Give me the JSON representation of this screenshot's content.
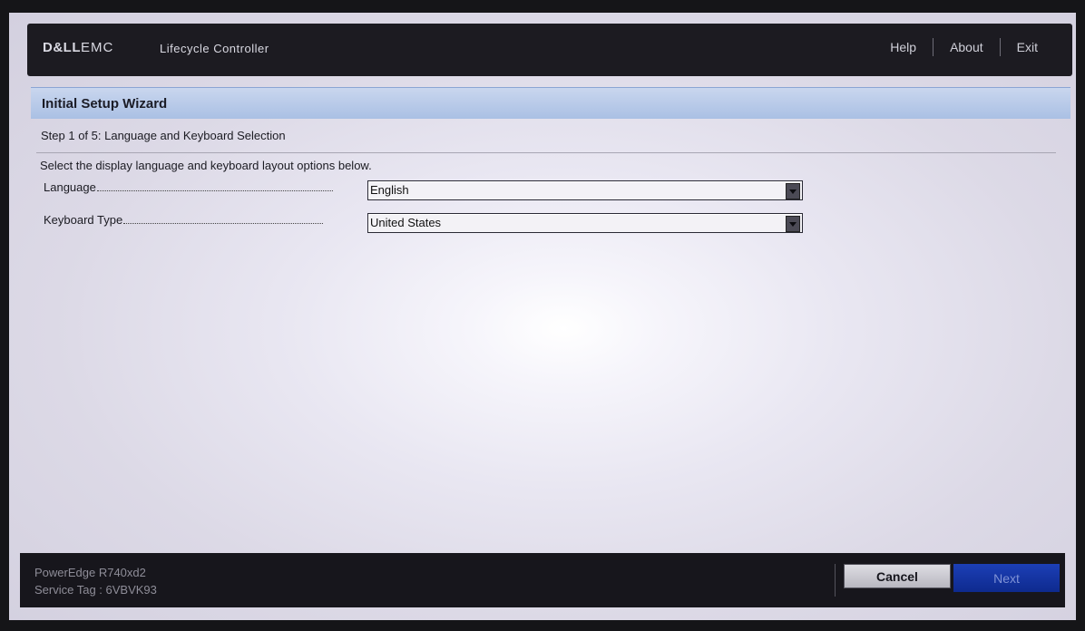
{
  "header": {
    "brand_left": "D&LL",
    "brand_right": "EMC",
    "app_title": "Lifecycle Controller",
    "nav": [
      {
        "label": "Help"
      },
      {
        "label": "About"
      },
      {
        "label": "Exit"
      }
    ]
  },
  "wizard": {
    "title": "Initial Setup Wizard",
    "step": "Step 1 of 5: Language and Keyboard Selection",
    "instructions": "Select the display language and keyboard layout options below.",
    "fields": [
      {
        "label": "Language",
        "value": "English"
      },
      {
        "label": "Keyboard Type",
        "value": "United States"
      }
    ]
  },
  "footer": {
    "model": "PowerEdge R740xd2",
    "service_tag": "Service Tag : 6VBVK93",
    "cancel_label": "Cancel",
    "next_label": "Next"
  },
  "colors": {
    "header_bg": "#1c1b21",
    "title_bar": "#aac0e4",
    "next_button": "#1c3fb6"
  }
}
